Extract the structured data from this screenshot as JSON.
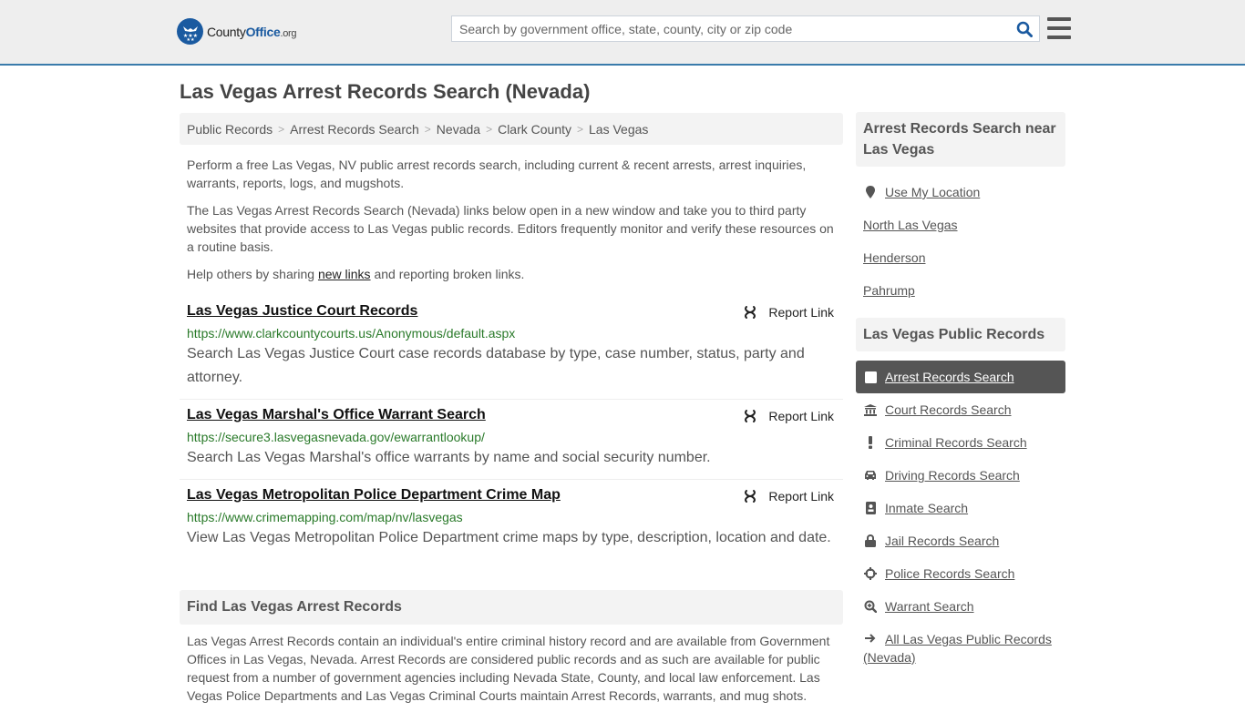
{
  "header": {
    "logo_prefix": "County",
    "logo_brand": "Office",
    "logo_tld": ".org",
    "search_placeholder": "Search by government office, state, county, city or zip code",
    "accent_color": "#3a7bab"
  },
  "page": {
    "title": "Las Vegas Arrest Records Search (Nevada)"
  },
  "breadcrumb": [
    "Public Records",
    "Arrest Records Search",
    "Nevada",
    "Clark County",
    "Las Vegas"
  ],
  "intro": {
    "p1": "Perform a free Las Vegas, NV public arrest records search, including current & recent arrests, arrest inquiries, warrants, reports, logs, and mugshots.",
    "p2": "The Las Vegas Arrest Records Search (Nevada) links below open in a new window and take you to third party websites that provide access to Las Vegas public records. Editors frequently monitor and verify these resources on a routine basis.",
    "p3_before": "Help others by sharing ",
    "p3_link": "new links",
    "p3_after": " and reporting broken links."
  },
  "results": [
    {
      "title": "Las Vegas Justice Court Records",
      "url": "https://www.clarkcountycourts.us/Anonymous/default.aspx",
      "description": "Search Las Vegas Justice Court case records database by type, case number, status, party and attorney.",
      "report_label": "Report Link"
    },
    {
      "title": "Las Vegas Marshal's Office Warrant Search",
      "url": "https://secure3.lasvegasnevada.gov/ewarrantlookup/",
      "description": "Search Las Vegas Marshal's office warrants by name and social security number.",
      "report_label": "Report Link"
    },
    {
      "title": "Las Vegas Metropolitan Police Department Crime Map",
      "url": "https://www.crimemapping.com/map/nv/lasvegas",
      "description": "View Las Vegas Metropolitan Police Department crime maps by type, description, location and date.",
      "report_label": "Report Link"
    }
  ],
  "find": {
    "heading": "Find Las Vegas Arrest Records",
    "body": "Las Vegas Arrest Records contain an individual's entire criminal history record and are available from Government Offices in Las Vegas, Nevada. Arrest Records are considered public records and as such are available for public request from a number of government agencies including Nevada State, County, and local law enforcement. Las Vegas Police Departments and Las Vegas Criminal Courts maintain Arrest Records, warrants, and mug shots."
  },
  "sidebar": {
    "near_heading": "Arrest Records Search near Las Vegas",
    "near_items": [
      {
        "label": "Use My Location",
        "icon": "map-marker-icon"
      },
      {
        "label": "North Las Vegas"
      },
      {
        "label": "Henderson"
      },
      {
        "label": "Pahrump"
      }
    ],
    "records_heading": "Las Vegas Public Records",
    "records_items": [
      {
        "label": "Arrest Records Search",
        "icon": "square-icon",
        "active": true
      },
      {
        "label": "Court Records Search",
        "icon": "courthouse-icon"
      },
      {
        "label": "Criminal Records Search",
        "icon": "exclamation-icon"
      },
      {
        "label": "Driving Records Search",
        "icon": "car-icon"
      },
      {
        "label": "Inmate Search",
        "icon": "id-badge-icon"
      },
      {
        "label": "Jail Records Search",
        "icon": "lock-icon"
      },
      {
        "label": "Police Records Search",
        "icon": "crosshairs-icon"
      },
      {
        "label": "Warrant Search",
        "icon": "search-plus-icon"
      },
      {
        "label": "All Las Vegas Public Records (Nevada)",
        "icon": "arrow-right-icon"
      }
    ]
  }
}
